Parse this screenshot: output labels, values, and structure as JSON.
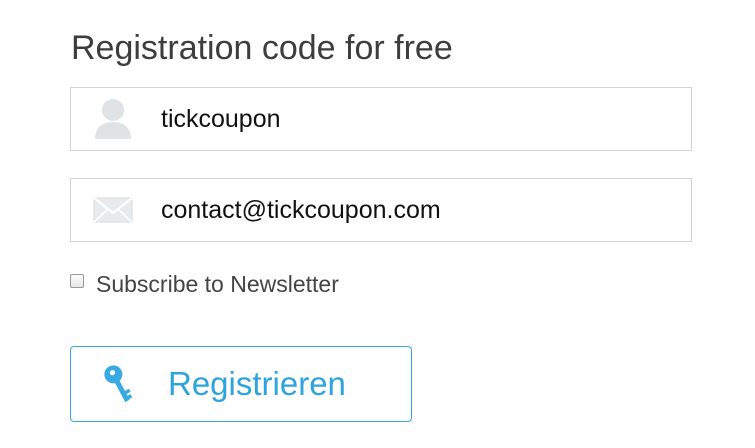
{
  "form": {
    "title": "Registration code for free",
    "name_field": {
      "value": "tickcoupon",
      "icon": "user-icon"
    },
    "email_field": {
      "value": "contact@tickcoupon.com",
      "icon": "envelope-icon"
    },
    "newsletter": {
      "label": "Subscribe to Newsletter",
      "checked": false
    },
    "register_button": {
      "label": "Registrieren",
      "icon": "key-icon"
    }
  },
  "colors": {
    "accent": "#2ea4de",
    "border": "#d4d4d4",
    "icon_gray": "#e0e3e6",
    "title_text": "#3d3d3d"
  }
}
